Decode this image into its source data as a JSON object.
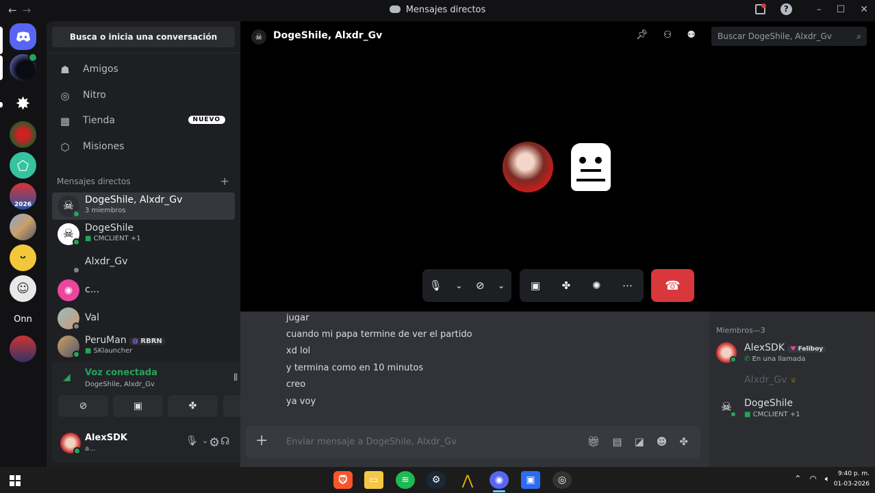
{
  "titlebar": {
    "title": "Mensajes directos",
    "back_icon": "←",
    "forward_icon": "→",
    "help_icon": "?",
    "minimize_icon": "–",
    "maximize_icon": "☐",
    "close_icon": "✕"
  },
  "servers": [
    {
      "label": ""
    },
    {
      "label": "Onn"
    }
  ],
  "dm_panel": {
    "search_label": "Busca o inicia una conversación",
    "nav": [
      {
        "label": "Amigos",
        "icon": "friends-icon"
      },
      {
        "label": "Nitro",
        "icon": "nitro-icon"
      },
      {
        "label": "Tienda",
        "icon": "shop-icon",
        "badge": "NUEVO"
      },
      {
        "label": "Misiones",
        "icon": "quests-icon"
      }
    ],
    "section_title": "Mensajes directos",
    "add_icon": "+",
    "dms": [
      {
        "name": "DogeShile, Alxdr_Gv",
        "sub": "3 miembros"
      },
      {
        "name": "DogeShile",
        "sub": "CMCLIENT +1"
      },
      {
        "name": "Alxdr_Gv",
        "sub": ""
      },
      {
        "name": "c...",
        "sub": ""
      },
      {
        "name": "Val",
        "sub": ""
      },
      {
        "name": "PeruMan",
        "tag": "RBRN",
        "sub": "SKlauncher"
      }
    ]
  },
  "voice": {
    "title": "Voz conectada",
    "channel": "DogeShile, Alxdr_Gv"
  },
  "user": {
    "name": "AlexSDK",
    "status": "a..."
  },
  "main": {
    "header_title": "DogeShile, Alxdr_Gv",
    "search_placeholder": "Buscar DogeShile, Alxdr_Gv",
    "messages": [
      "jugar",
      "cuando mi papa termine de ver el partido",
      "xd lol",
      "y termina como en 10 minutos",
      "creo",
      "ya voy"
    ],
    "composer_placeholder": "Enviar mensaje a DogeShile, Alxdr_Gv",
    "composer_plus": "+"
  },
  "members": {
    "header": "Miembros—3",
    "list": [
      {
        "name": "AlexSDK",
        "tag": "Feliboy",
        "sub": "En una llamada"
      },
      {
        "name": "Alxdr_Gv",
        "sub": ""
      },
      {
        "name": "DogeShile",
        "sub": "CMCLIENT +1"
      }
    ]
  },
  "taskbar": {
    "time": "9:40 p. m.",
    "date": "01-03-2026"
  },
  "colors": {
    "accent": "#5865f2",
    "online": "#23a55a",
    "danger": "#da373c"
  }
}
